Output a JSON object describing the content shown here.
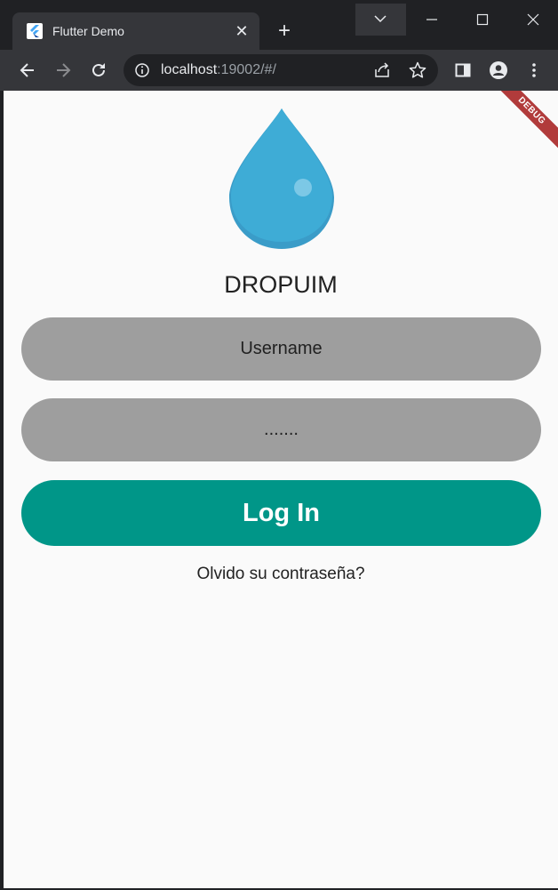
{
  "browser": {
    "tab_title": "Flutter Demo",
    "tab_close_glyph": "✕",
    "new_tab_glyph": "+",
    "url_host": "localhost",
    "url_rest": ":19002/#/",
    "icons": [
      "flutter-favicon-icon",
      "tab-search-icon",
      "minimize-icon",
      "maximize-icon",
      "window-close-icon",
      "back-icon",
      "forward-icon",
      "reload-icon",
      "site-info-icon",
      "share-icon",
      "bookmark-star-icon",
      "side-panel-icon",
      "profile-icon",
      "menu-icon"
    ]
  },
  "app": {
    "debug_banner": "DEBUG",
    "title": "DROPUIM",
    "username_placeholder": "Username",
    "password_value": ".......",
    "login_label": "Log In",
    "forgot_label": "Olvido su contraseña?",
    "logo_icon": "water-drop-icon",
    "colors": {
      "background": "#fafafa",
      "field": "#9e9e9e",
      "button": "#009688",
      "drop": "#3eacd6",
      "debug": "#b13b3b"
    }
  }
}
